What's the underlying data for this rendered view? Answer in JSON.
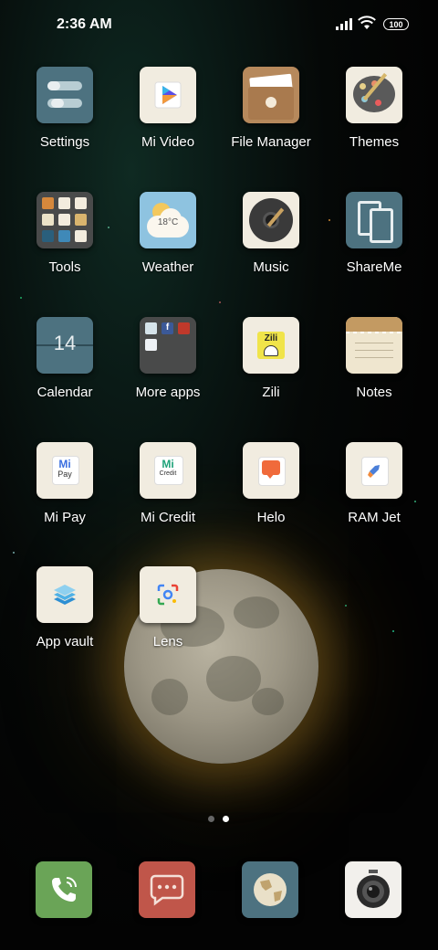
{
  "status_bar": {
    "time": "2:36 AM",
    "battery": "100"
  },
  "apps": [
    {
      "label": "Settings",
      "icon": "settings-icon"
    },
    {
      "label": "Mi Video",
      "icon": "play-icon"
    },
    {
      "label": "File Manager",
      "icon": "folder-icon"
    },
    {
      "label": "Themes",
      "icon": "palette-icon"
    },
    {
      "label": "Tools",
      "icon": "tools-folder-icon"
    },
    {
      "label": "Weather",
      "icon": "cloud-icon",
      "temp": "18°C"
    },
    {
      "label": "Music",
      "icon": "vinyl-icon"
    },
    {
      "label": "ShareMe",
      "icon": "share-devices-icon"
    },
    {
      "label": "Calendar",
      "icon": "calendar-icon",
      "day": "14"
    },
    {
      "label": "More apps",
      "icon": "apps-folder-icon"
    },
    {
      "label": "Zili",
      "icon": "zili-icon",
      "logo_text": "Zili"
    },
    {
      "label": "Notes",
      "icon": "notepad-icon"
    },
    {
      "label": "Mi Pay",
      "icon": "mi-pay-icon",
      "logo_text": "Pay"
    },
    {
      "label": "Mi Credit",
      "icon": "mi-credit-icon",
      "logo_text": "Credit"
    },
    {
      "label": "Helo",
      "icon": "chat-bubble-icon"
    },
    {
      "label": "RAM Jet",
      "icon": "rocket-icon"
    },
    {
      "label": "App vault",
      "icon": "layers-icon"
    },
    {
      "label": "Lens",
      "icon": "lens-icon"
    }
  ],
  "dock": [
    {
      "name": "phone",
      "icon": "phone-icon"
    },
    {
      "name": "messaging",
      "icon": "message-icon"
    },
    {
      "name": "browser",
      "icon": "globe-icon"
    },
    {
      "name": "camera",
      "icon": "camera-icon"
    }
  ],
  "page_indicator": {
    "pages": 2,
    "current": 2
  },
  "colors": {
    "accent_teal": "#4d7280",
    "dock_green": "#6aa457",
    "dock_red": "#c0564a",
    "cream": "#f1ece0"
  }
}
